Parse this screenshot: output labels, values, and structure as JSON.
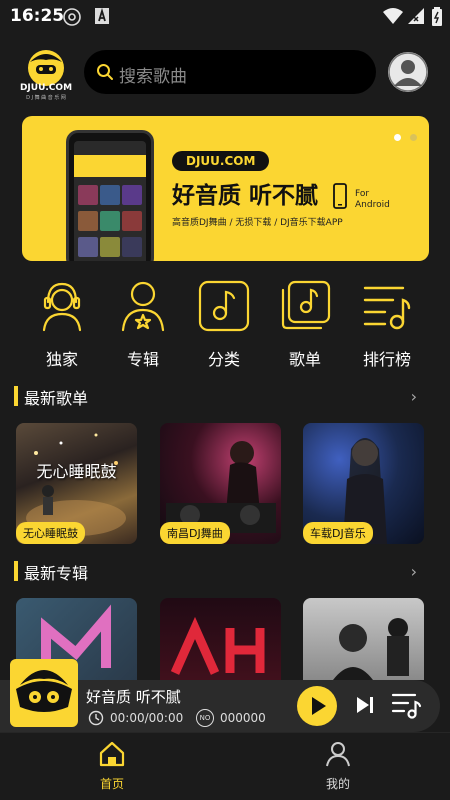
{
  "status": {
    "time": "16:25"
  },
  "header": {
    "logo_text": "DJUU.COM",
    "logo_sub": "D J 舞 曲 音 乐 网",
    "search_placeholder": "搜索歌曲"
  },
  "banner": {
    "site": "DJUU.COM",
    "title": "好音质 听不腻",
    "for_label": "For",
    "platform": "Android",
    "subtitle": "高音质DJ舞曲 / 无损下载 / DJ音乐下载APP",
    "accent": "#fbd632"
  },
  "categories": [
    {
      "label": "独家",
      "icon": "headphones-person-icon"
    },
    {
      "label": "专辑",
      "icon": "person-star-icon"
    },
    {
      "label": "分类",
      "icon": "music-note-square-icon"
    },
    {
      "label": "歌单",
      "icon": "stacked-music-note-icon"
    },
    {
      "label": "排行榜",
      "icon": "music-list-icon"
    }
  ],
  "sections": {
    "playlists": {
      "title": "最新歌单",
      "more": "›",
      "items": [
        {
          "tag": "无心睡眠鼓",
          "overlay": "无心睡眠鼓"
        },
        {
          "tag": "南昌DJ舞曲"
        },
        {
          "tag": "车载DJ音乐"
        }
      ]
    },
    "albums": {
      "title": "最新专辑",
      "more": "›"
    }
  },
  "player": {
    "title": "好音质 听不腻",
    "time": "00:00/00:00",
    "no_label": "NO",
    "number": "000000"
  },
  "tabs": [
    {
      "label": "首页",
      "icon": "home-icon",
      "active": true
    },
    {
      "label": "我的",
      "icon": "user-icon",
      "active": false
    }
  ],
  "colors": {
    "accent": "#fbd632",
    "background": "#1b1b1b"
  }
}
